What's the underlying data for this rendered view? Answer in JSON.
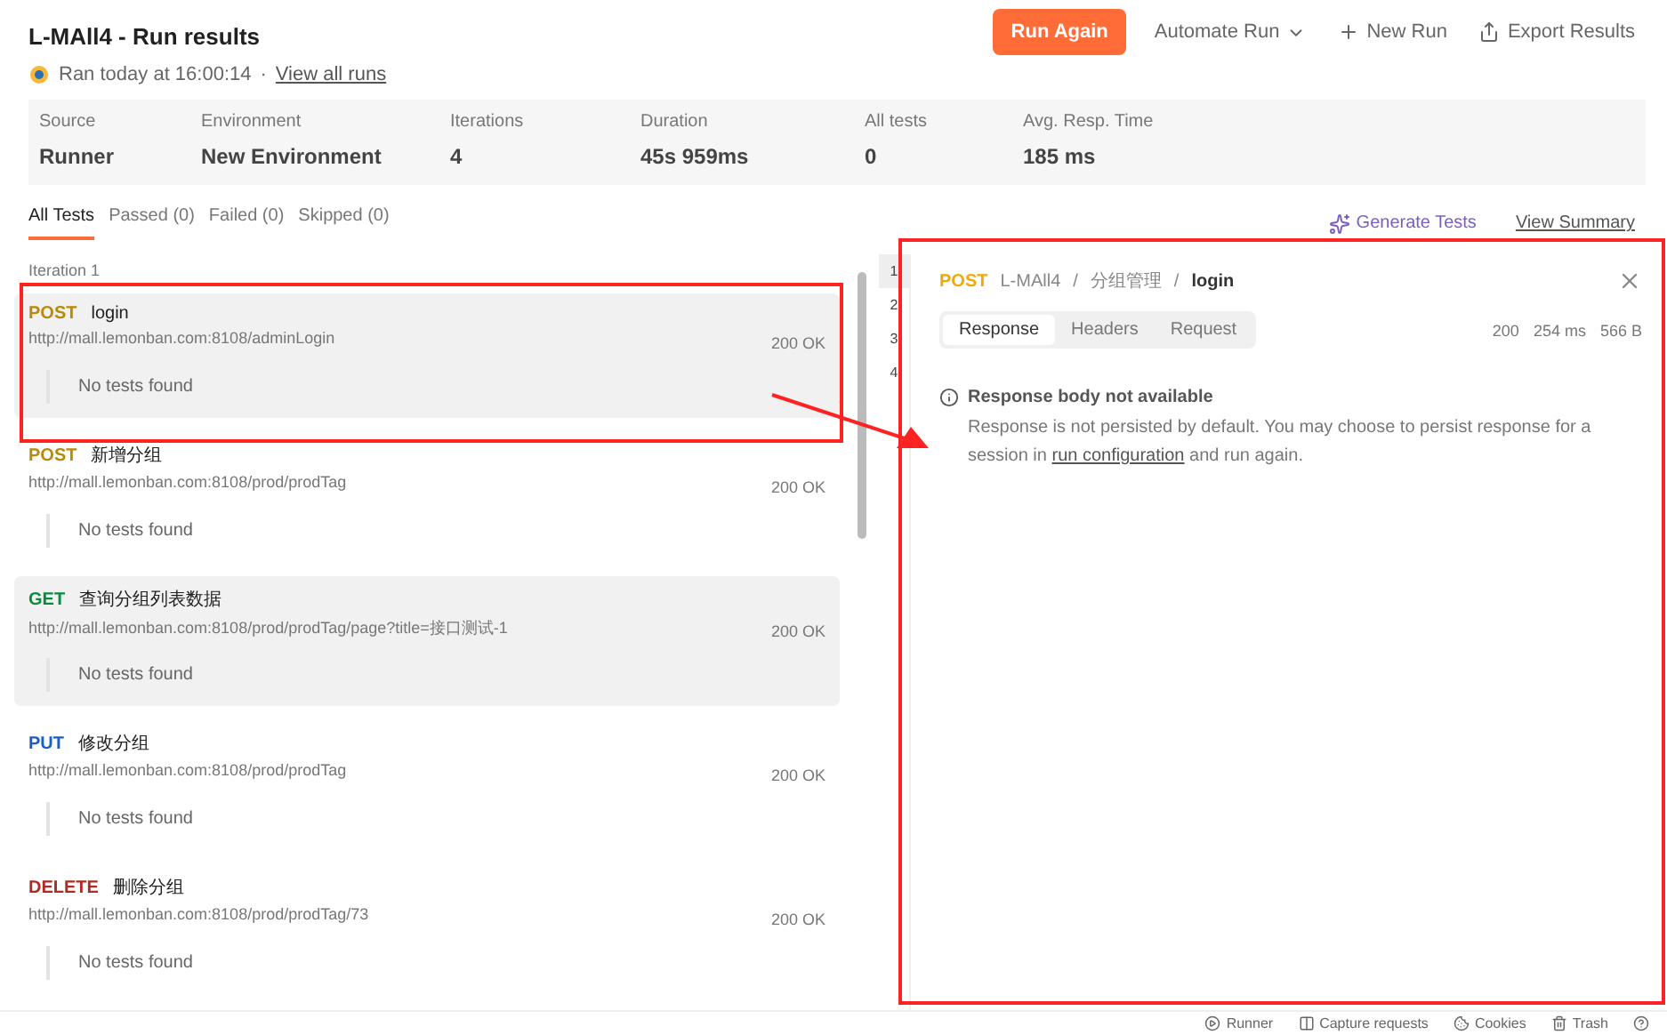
{
  "header": {
    "title": "L-MAll4 - Run results",
    "ran": "Ran today at 16:00:14",
    "separator": "·",
    "view_all": "View all runs",
    "actions": [
      {
        "kind": "primary",
        "label": "Run Again"
      },
      {
        "kind": "dropdown",
        "label": "Automate Run"
      },
      {
        "kind": "plus",
        "label": "New Run"
      },
      {
        "kind": "export",
        "label": "Export Results"
      }
    ]
  },
  "stats": [
    {
      "label": "Source",
      "value": "Runner"
    },
    {
      "label": "Environment",
      "value": "New Environment"
    },
    {
      "label": "Iterations",
      "value": "4"
    },
    {
      "label": "Duration",
      "value": "45s 959ms"
    },
    {
      "label": "All tests",
      "value": "0"
    },
    {
      "label": "Avg. Resp. Time",
      "value": "185 ms"
    }
  ],
  "tabs": [
    {
      "label": "All Tests",
      "selected": true
    },
    {
      "label": "Passed (0)",
      "selected": false
    },
    {
      "label": "Failed (0)",
      "selected": false
    },
    {
      "label": "Skipped (0)",
      "selected": false
    }
  ],
  "links": {
    "generate": "Generate Tests",
    "summary": "View Summary"
  },
  "iteration_title": "Iteration 1",
  "requests": [
    {
      "method": "POST",
      "color": "#b88a09",
      "name": "login",
      "url": "http://mall.lemonban.com:8108/adminLogin",
      "status": "200 OK",
      "result": "No tests found",
      "highlighted": true
    },
    {
      "method": "POST",
      "color": "#b88a09",
      "name": "新增分组",
      "url": "http://mall.lemonban.com:8108/prod/prodTag",
      "status": "200 OK",
      "result": "No tests found",
      "highlighted": false
    },
    {
      "method": "GET",
      "color": "#0b8a3e",
      "name": "查询分组列表数据",
      "url": "http://mall.lemonban.com:8108/prod/prodTag/page?title=接口测试-1",
      "status": "200 OK",
      "result": "No tests found",
      "highlighted": true
    },
    {
      "method": "PUT",
      "color": "#1b5fc4",
      "name": "修改分组",
      "url": "http://mall.lemonban.com:8108/prod/prodTag",
      "status": "200 OK",
      "result": "No tests found",
      "highlighted": false
    },
    {
      "method": "DELETE",
      "color": "#b02a25",
      "name": "删除分组",
      "url": "http://mall.lemonban.com:8108/prod/prodTag/73",
      "status": "200 OK",
      "result": "No tests found",
      "highlighted": false
    }
  ],
  "iterations": [
    {
      "label": "1",
      "selected": true
    },
    {
      "label": "2",
      "selected": false
    },
    {
      "label": "3",
      "selected": false
    },
    {
      "label": "4",
      "selected": false
    }
  ],
  "detail": {
    "method": "POST",
    "breadcrumb": [
      "L-MAll4",
      "分组管理"
    ],
    "name": "login",
    "slash": "/",
    "tabs": [
      {
        "label": "Response",
        "selected": true
      },
      {
        "label": "Headers",
        "selected": false
      },
      {
        "label": "Request",
        "selected": false
      }
    ],
    "meta": [
      "200",
      "254 ms",
      "566 B"
    ],
    "notice_title": "Response body not available",
    "notice_text": "Response is not persisted by default. You may choose to persist response for a session in",
    "notice_link": "run configuration",
    "notice_tail": "and run again."
  },
  "footer": [
    "Runner",
    "Capture requests",
    "Cookies",
    "Trash"
  ]
}
